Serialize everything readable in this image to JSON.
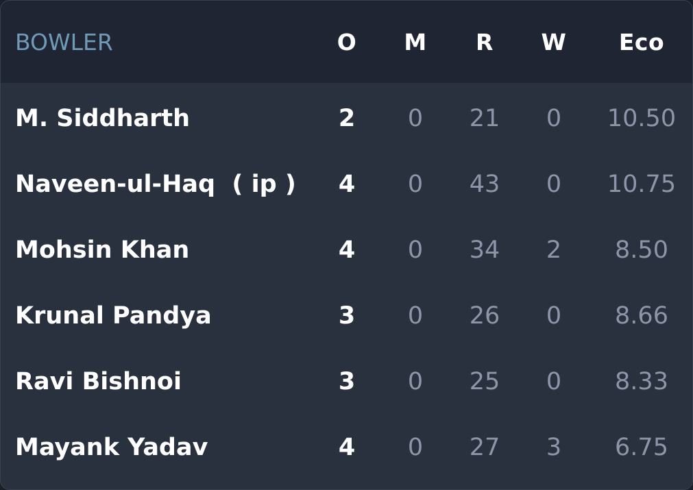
{
  "colors": {
    "background": "#2a313e",
    "header_background": "#1f2532",
    "header_bowler_label": "#6f9ab8",
    "primary_text": "#ffffff",
    "muted_text": "#8d96a8"
  },
  "header": {
    "bowler": "BOWLER",
    "overs": "O",
    "maidens": "M",
    "runs": "R",
    "wickets": "W",
    "economy": "Eco"
  },
  "bowlers": [
    {
      "name": "M. Siddharth",
      "overs": "2",
      "maidens": "0",
      "runs": "21",
      "wickets": "0",
      "economy": "10.50"
    },
    {
      "name": "Naveen-ul-Haq  ( ip )",
      "overs": "4",
      "maidens": "0",
      "runs": "43",
      "wickets": "0",
      "economy": "10.75"
    },
    {
      "name": "Mohsin Khan",
      "overs": "4",
      "maidens": "0",
      "runs": "34",
      "wickets": "2",
      "economy": "8.50"
    },
    {
      "name": "Krunal Pandya",
      "overs": "3",
      "maidens": "0",
      "runs": "26",
      "wickets": "0",
      "economy": "8.66"
    },
    {
      "name": "Ravi Bishnoi",
      "overs": "3",
      "maidens": "0",
      "runs": "25",
      "wickets": "0",
      "economy": "8.33"
    },
    {
      "name": "Mayank Yadav",
      "overs": "4",
      "maidens": "0",
      "runs": "27",
      "wickets": "3",
      "economy": "6.75"
    }
  ]
}
